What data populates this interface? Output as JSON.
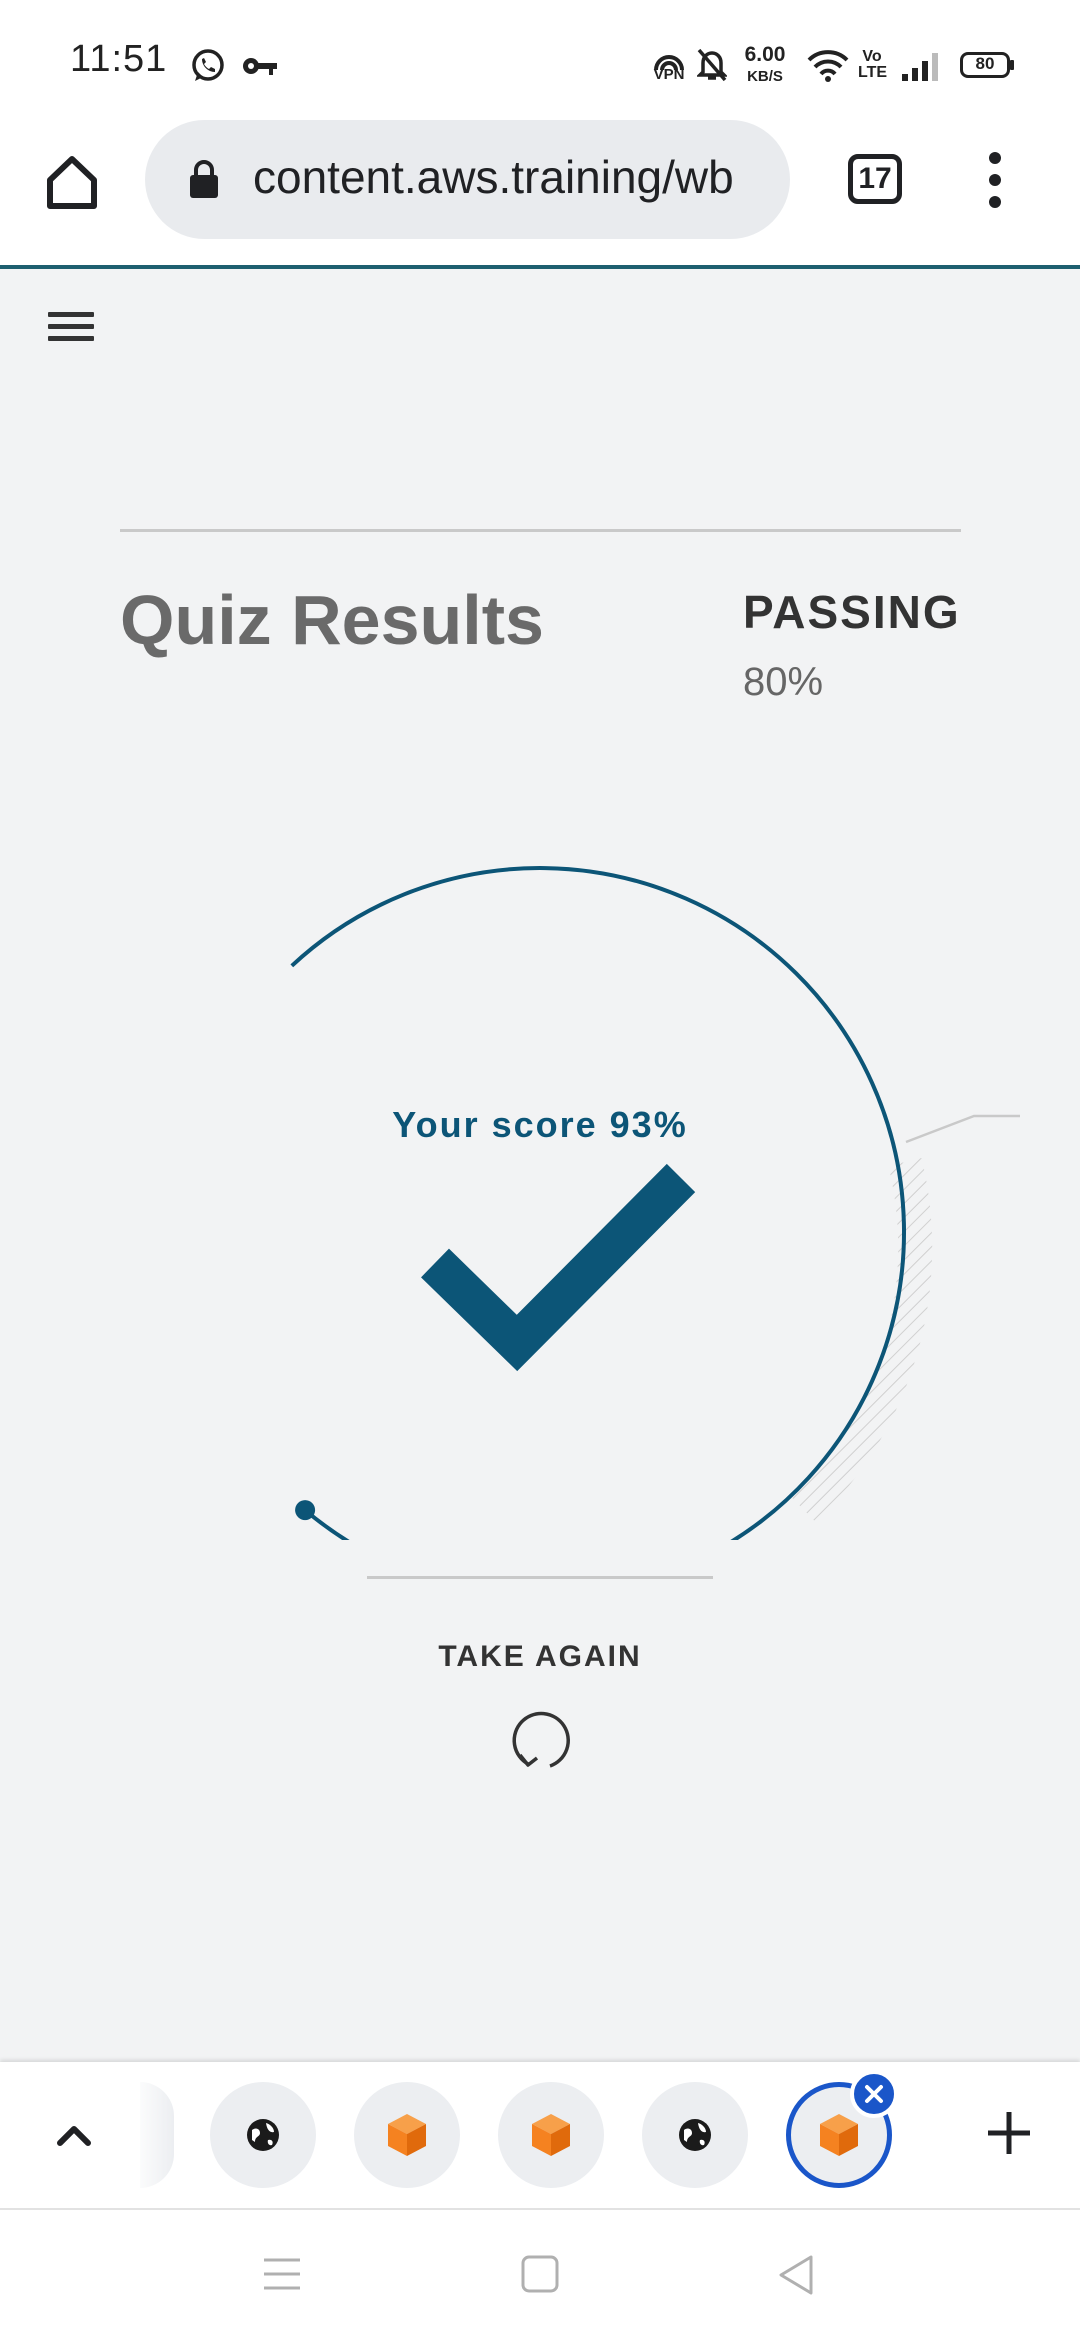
{
  "status_bar": {
    "time": "11:51",
    "net_speed_value": "6.00",
    "net_speed_unit": "KB/S",
    "vpn_label": "VPN",
    "volte_label_1": "Vo",
    "volte_label_2": "LTE",
    "battery_level": "80",
    "icons": [
      "whatsapp-icon",
      "key-icon",
      "vpn-icon",
      "bell-muted-icon",
      "wifi-icon",
      "volte-icon",
      "signal-icon",
      "battery-icon"
    ]
  },
  "browser": {
    "url": "content.aws.training/wb",
    "tab_count": "17"
  },
  "quiz": {
    "title": "Quiz Results",
    "passing_label": "PASSING",
    "passing_value": "80%",
    "score_text": "Your score 93%",
    "score_percent": 93,
    "take_again_label": "TAKE AGAIN"
  },
  "colors": {
    "accent": "#0c5577",
    "page_bg": "#f2f3f4",
    "active_tab": "#1a56c9"
  },
  "tab_strip": {
    "tabs": [
      "globe-icon",
      "aws-cube-icon",
      "aws-cube-icon",
      "globe-icon",
      "aws-cube-icon"
    ],
    "active_index": 4
  }
}
